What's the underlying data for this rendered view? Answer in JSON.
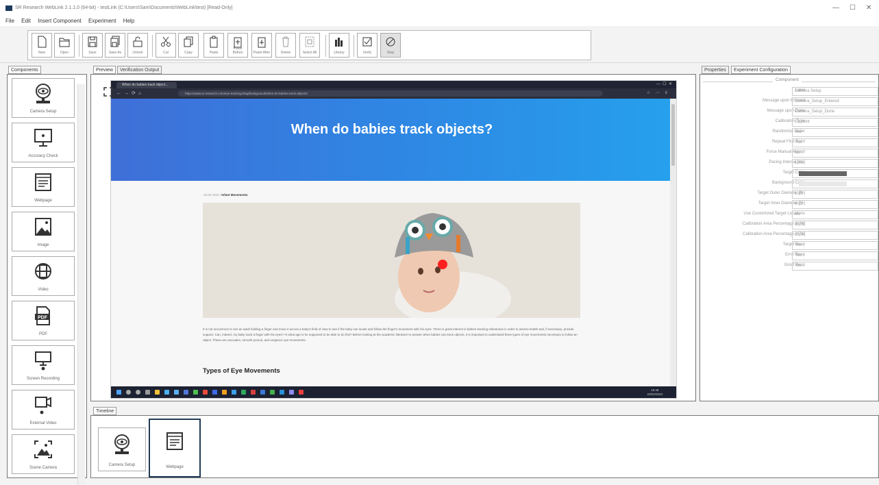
{
  "window": {
    "title": "SR Research WebLink 2.1.1.0 (64-bit) - testLink (C:\\Users\\Sam\\Documents\\WebLink\\test) [Read-Only]",
    "controls": [
      "—",
      "☐",
      "✕"
    ]
  },
  "menu": [
    "File",
    "Edit",
    "Insert Component",
    "Experiment",
    "Help"
  ],
  "toolbar": [
    {
      "label": "New",
      "icon": "new-file-icon"
    },
    {
      "label": "Open",
      "icon": "folder-open-icon"
    },
    {
      "label": "Save",
      "icon": "save-icon"
    },
    {
      "label": "Save As",
      "icon": "save-as-icon"
    },
    {
      "label": "Unlock",
      "icon": "unlock-icon"
    },
    {
      "label": "Cut",
      "icon": "scissors-icon"
    },
    {
      "label": "Copy",
      "icon": "copy-icon"
    },
    {
      "label": "Paste",
      "icon": "clipboard-icon"
    },
    {
      "label": "Paste Before",
      "icon": "paste-before-icon"
    },
    {
      "label": "Paste After",
      "icon": "paste-after-icon"
    },
    {
      "label": "Delete",
      "icon": "trash-icon"
    },
    {
      "label": "Select All",
      "icon": "select-all-icon"
    },
    {
      "label": "Library",
      "icon": "library-icon"
    },
    {
      "label": "Verify",
      "icon": "checkbox-icon"
    },
    {
      "label": "Stop",
      "icon": "stop-icon"
    }
  ],
  "left_panel": {
    "tab": "Components",
    "items": [
      "Camera Setup",
      "Accuracy Check",
      "Webpage",
      "Image",
      "Video",
      "PDF",
      "Screen Recording",
      "External Video",
      "Scene Camera"
    ]
  },
  "center_panel": {
    "tabs": [
      "Preview",
      "Verification Output"
    ],
    "browser": {
      "tab_title": "When do babies track object...",
      "url": "https://www.sr-research.com/eye-tracking-blog/background/when-do-babies-track-objects/",
      "hero_title": "When do babies track objects?",
      "meta_date": "23.02.2023",
      "meta_tag": "Infant Movements",
      "paragraph": "It is not uncommon to see an adult holding a finger and move it across a baby's field of view to see if the baby can locate and follow the finger's movement with his eyes. There is great interest in babies tracking milestones in order to assess health and, if necessary, provide support. Can, indeed, my baby track a finger with his eyes? At what age is he supposed to be able to do this? Before looking at the academic literature to answer when babies can track objects, it is important to understand three types of eye movements necessary to follow an object. These are saccades, smooth pursuit, and vergence eye movements.",
      "section_heading": "Types of Eye Movements",
      "clock_time": "15:48",
      "clock_date": "23/02/2023"
    }
  },
  "right_panel": {
    "tabs": [
      "Properties",
      "Experiment Configuration"
    ],
    "section": "Component",
    "properties": [
      {
        "key": "Label",
        "value": "Camera Setup"
      },
      {
        "key": "Message upon Entered",
        "value": "Camera_Setup_Entered"
      },
      {
        "key": "Message upon Done",
        "value": "Camera_Setup_Done"
      },
      {
        "key": "Calibration Type",
        "value": "13-point"
      },
      {
        "key": "Randomize Order",
        "value": "Yes"
      },
      {
        "key": "Repeat First Point",
        "value": "Yes"
      },
      {
        "key": "Force Manual Accept",
        "value": "No"
      },
      {
        "key": "Pacing Interval [ms]",
        "value": "1000"
      },
      {
        "key": "Target Color",
        "value": ""
      },
      {
        "key": "Background Color",
        "value": ""
      },
      {
        "key": "Target Outer Diameter [%]",
        "value": "1.95"
      },
      {
        "key": "Target Inner Diameter [%]",
        "value": "0.52"
      },
      {
        "key": "Use Customized Target Locations",
        "value": "No"
      },
      {
        "key": "Calibration Area Percentage X [%]",
        "value": "88.00"
      },
      {
        "key": "Calibration Area Percentage Y [%]",
        "value": "88.00"
      },
      {
        "key": "Target Beep",
        "value": "Yes"
      },
      {
        "key": "Error Beep",
        "value": "Yes"
      },
      {
        "key": "Good Beep",
        "value": "Yes"
      }
    ],
    "colors": {
      "target": "#666666",
      "background": "#e8e8e8"
    }
  },
  "timeline": {
    "tab": "Timeline",
    "items": [
      "Camera Setup",
      "Webpage"
    ]
  }
}
